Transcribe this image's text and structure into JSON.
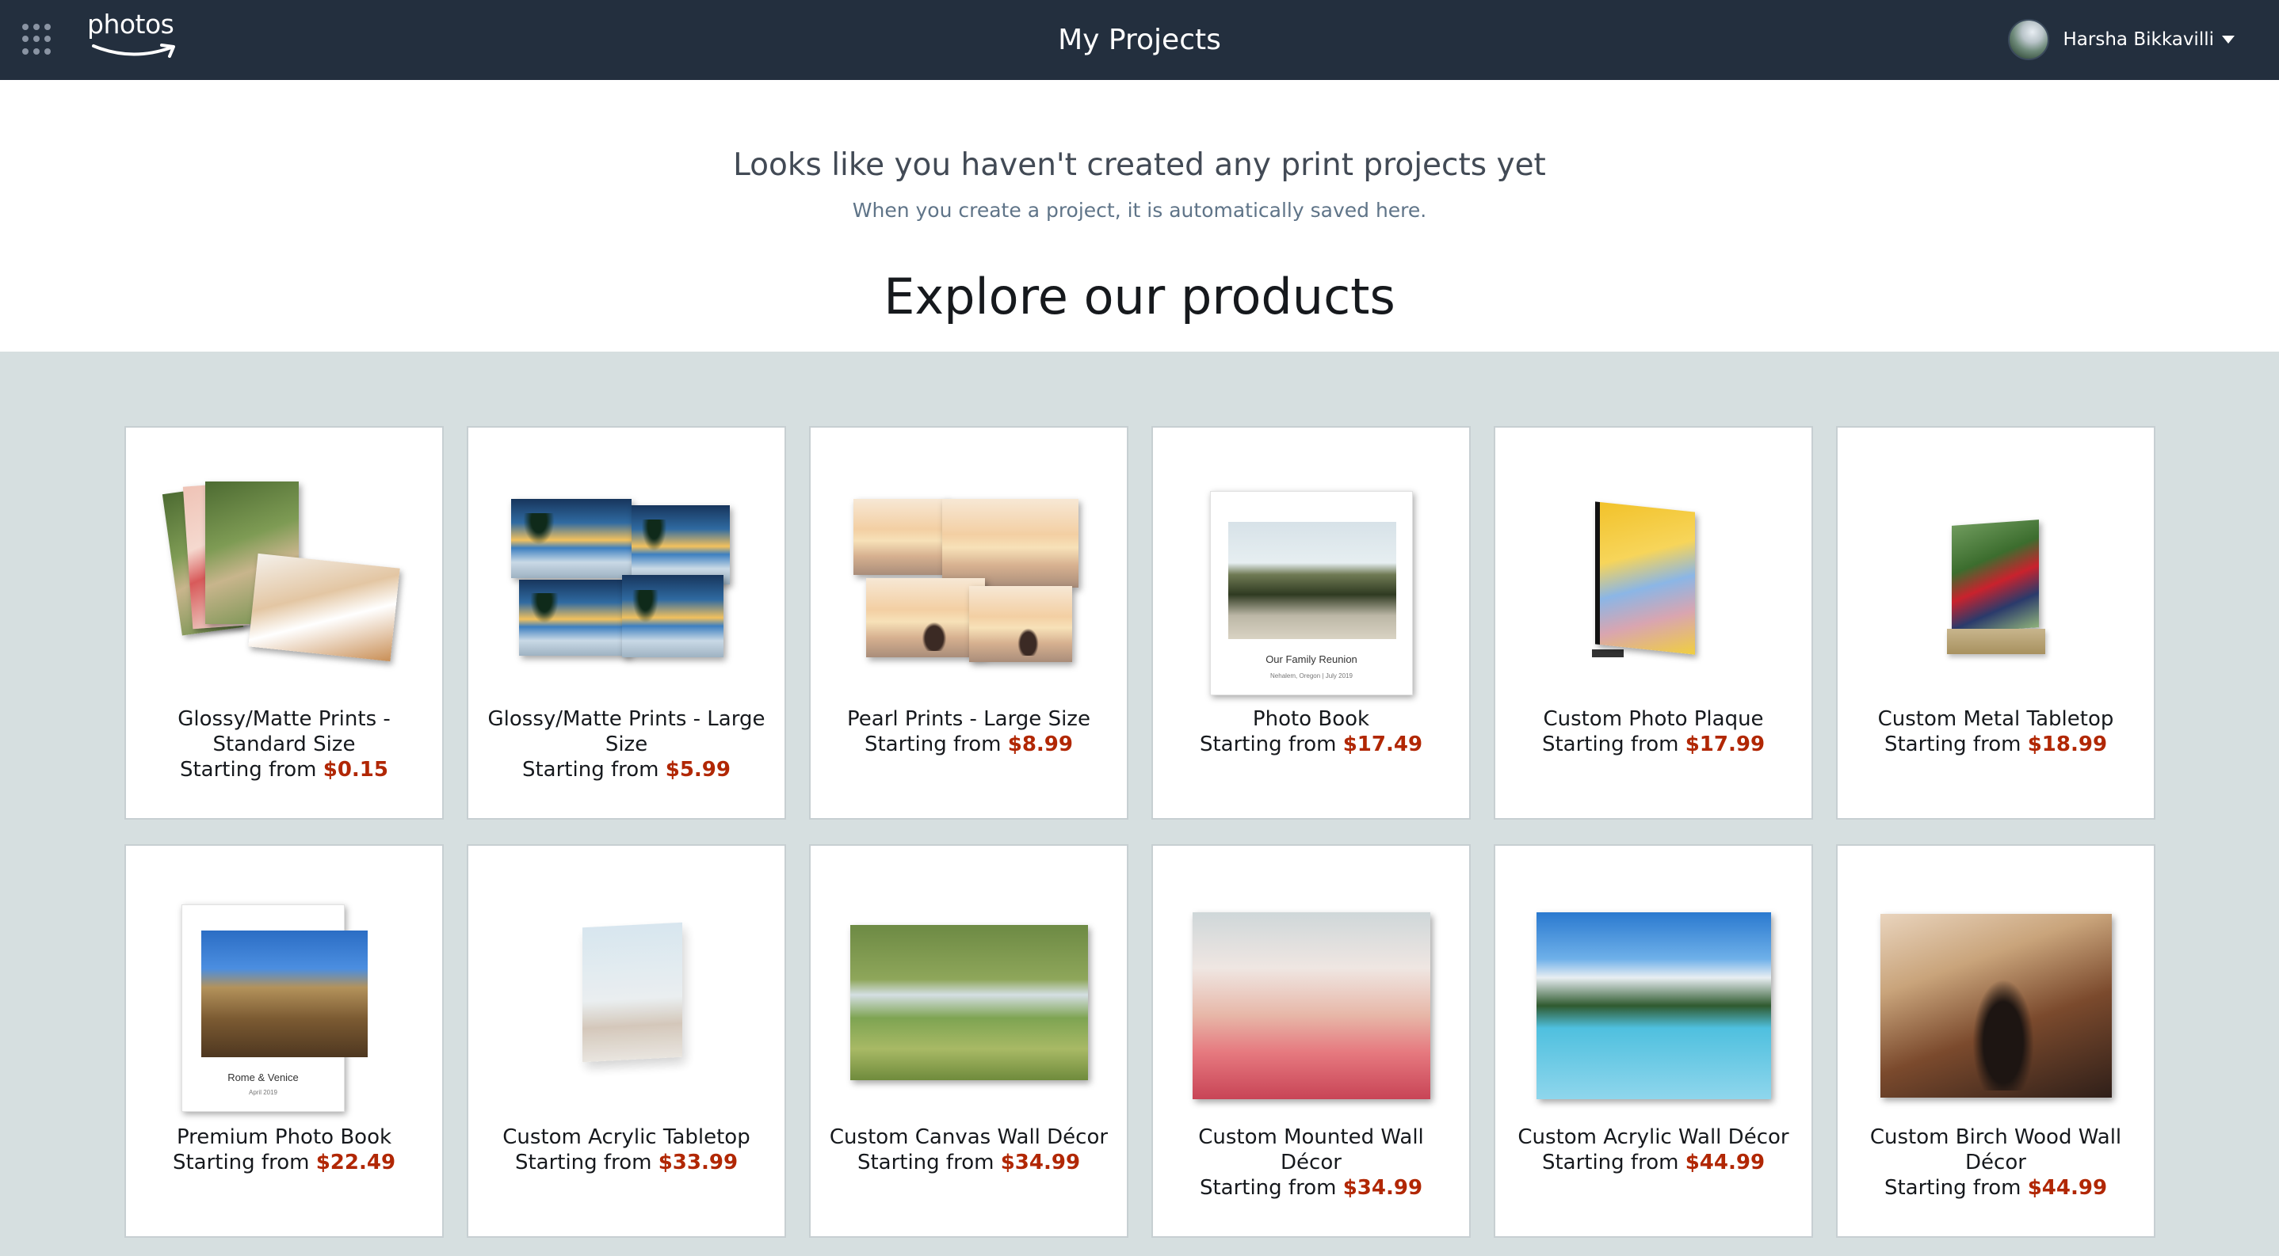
{
  "header": {
    "apps_icon": "grid-icon",
    "logo_text": "photos",
    "page_title": "My Projects",
    "user_name": "Harsha Bikkavilli",
    "caret_icon": "caret-down-icon"
  },
  "empty_state": {
    "title": "Looks like you haven't created any print projects yet",
    "subtitle": "When you create a project, it is automatically saved here."
  },
  "explore_title": "Explore our products",
  "colors": {
    "header_bg": "#232f3e",
    "price": "#b12704",
    "grid_bg": "#d6dfe0"
  },
  "products": [
    {
      "name": "Glossy/Matte Prints - Standard Size",
      "price_prefix": "Starting from",
      "price": "$0.15"
    },
    {
      "name": "Glossy/Matte Prints - Large Size",
      "price_prefix": "Starting from",
      "price": "$5.99"
    },
    {
      "name": "Pearl Prints - Large Size",
      "price_prefix": "Starting from",
      "price": "$8.99"
    },
    {
      "name": "Photo Book",
      "price_prefix": "Starting from",
      "price": "$17.49",
      "cover_title": "Our Family Reunion",
      "cover_sub": "Nehalem, Oregon | July 2019"
    },
    {
      "name": "Custom Photo Plaque",
      "price_prefix": "Starting from",
      "price": "$17.99"
    },
    {
      "name": "Custom Metal Tabletop",
      "price_prefix": "Starting from",
      "price": "$18.99"
    },
    {
      "name": "Premium Photo Book",
      "price_prefix": "Starting from",
      "price": "$22.49",
      "cover_title": "Rome & Venice",
      "cover_sub": "April 2019"
    },
    {
      "name": "Custom Acrylic Tabletop",
      "price_prefix": "Starting from",
      "price": "$33.99"
    },
    {
      "name": "Custom Canvas Wall Décor",
      "price_prefix": "Starting from",
      "price": "$34.99"
    },
    {
      "name": "Custom Mounted Wall Décor",
      "price_prefix": "Starting from",
      "price": "$34.99"
    },
    {
      "name": "Custom Acrylic Wall Décor",
      "price_prefix": "Starting from",
      "price": "$44.99"
    },
    {
      "name": "Custom Birch Wood Wall Décor",
      "price_prefix": "Starting from",
      "price": "$44.99"
    }
  ]
}
